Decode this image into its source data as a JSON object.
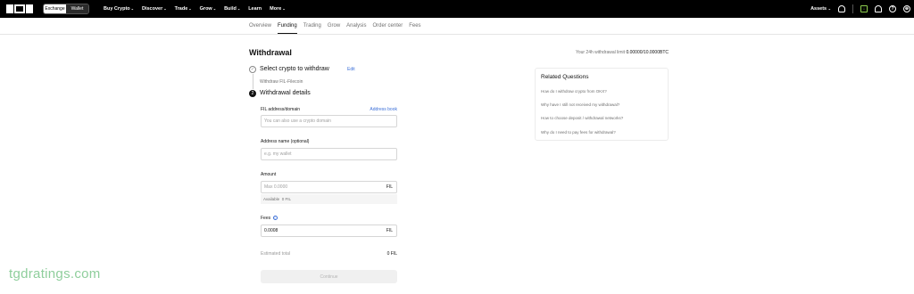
{
  "topnav": {
    "switch": {
      "exchange": "Exchange",
      "wallet": "Wallet"
    },
    "menu": [
      {
        "label": "Buy Crypto",
        "chevron": "⌄"
      },
      {
        "label": "Discover",
        "chevron": "⌄"
      },
      {
        "label": "Trade",
        "chevron": "⌄"
      },
      {
        "label": "Grow",
        "chevron": "⌄"
      },
      {
        "label": "Build",
        "chevron": "⌄"
      },
      {
        "label": "Learn",
        "chevron": ""
      },
      {
        "label": "More",
        "chevron": "⌄"
      }
    ],
    "assets": "Assets",
    "assets_chevron": "⌄",
    "icons": [
      "user-icon",
      "download-icon",
      "bell-icon",
      "help-icon",
      "globe-icon"
    ]
  },
  "subnav": {
    "tabs": [
      "Overview",
      "Funding",
      "Trading",
      "Grow",
      "Analysis",
      "Order center",
      "Fees"
    ],
    "selected": "Funding"
  },
  "main": {
    "title": "Withdrawal",
    "limit_label": "Your 24h withdrawal limit",
    "limit_value": "0.00000/10.0000BTC",
    "step1": {
      "label": "Select crypto to withdraw",
      "edit": "Edit",
      "sub": "Withdraw FIL-Filecoin",
      "icon_glyph": "✓"
    },
    "step2": {
      "label": "Withdrawal details",
      "icon_glyph": "2"
    },
    "address": {
      "label": "FIL address/domain",
      "link": "Address book",
      "placeholder": "You can also use a crypto domain"
    },
    "address_name": {
      "label": "Address name (optional)",
      "placeholder": "e.g. my wallet"
    },
    "amount": {
      "label": "Amount",
      "placeholder": "Max 0.0000",
      "unit": "FIL",
      "available_label": "Available",
      "available_value": "0 FIL"
    },
    "fees": {
      "label": "Fees",
      "info": "i",
      "value": "0.0008",
      "unit": "FIL"
    },
    "estimated": {
      "label": "Estimated total",
      "value": "0 FIL"
    },
    "continue_label": "Continue"
  },
  "related": {
    "title": "Related Questions",
    "questions": [
      "How do I withdraw crypto from OKX?",
      "Why have I still not received my withdrawal?",
      "How to choose deposit / withdrawal networks?",
      "Why do I need to pay fees for withdrawal?"
    ]
  },
  "watermark": "tgdratings.com",
  "colors": {
    "accent": "#3b6fd8",
    "nav_bg": "#000000",
    "watermark": "#8fce9c"
  }
}
